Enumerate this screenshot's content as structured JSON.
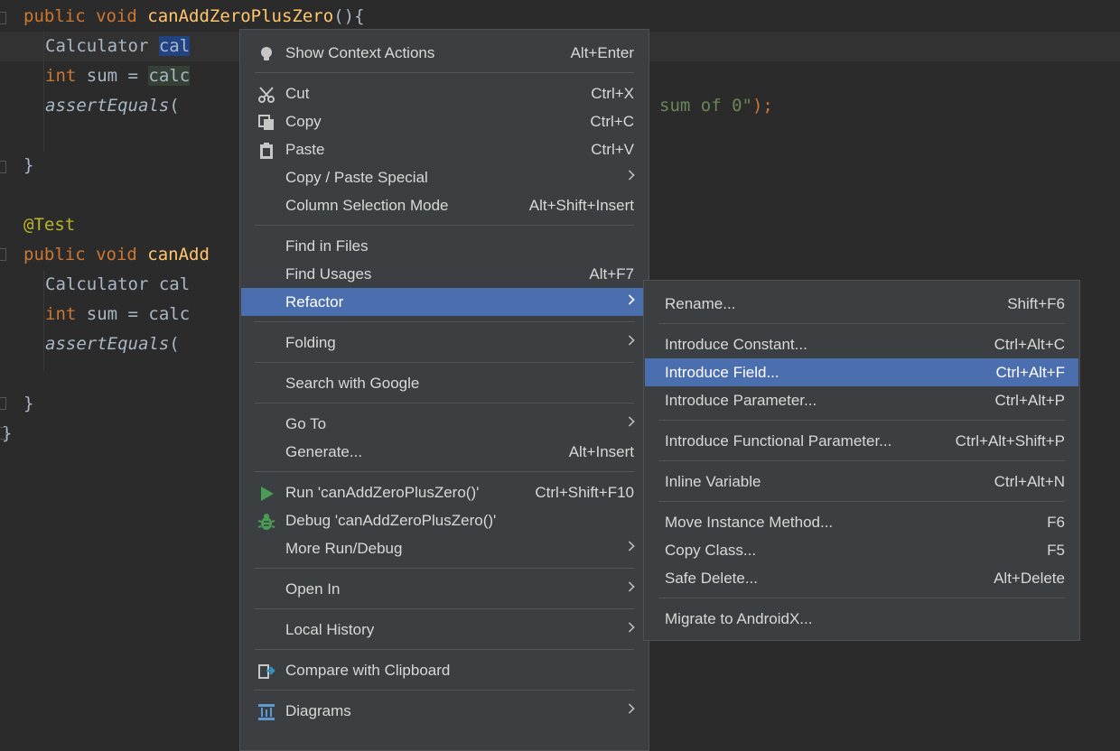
{
  "editor": {
    "lines": [
      {
        "tokens": [
          {
            "t": "public void ",
            "c": "kw"
          },
          {
            "t": "canAddZeroPlusZero",
            "c": "fn"
          },
          {
            "t": "(){",
            "c": ""
          }
        ],
        "indent": 2
      },
      {
        "tokens": [
          {
            "t": "Calculator ",
            "c": ""
          },
          {
            "t": "cal",
            "c": "sel"
          }
        ],
        "indent": 4,
        "current": true
      },
      {
        "tokens": [
          {
            "t": "int ",
            "c": "kw"
          },
          {
            "t": "sum = ",
            "c": ""
          },
          {
            "t": "calc",
            "c": "ref"
          }
        ],
        "indent": 4
      },
      {
        "tokens": [
          {
            "t": "assertEquals",
            "c": "it"
          },
          {
            "t": "(",
            "c": ""
          }
        ],
        "indent": 4,
        "tail": [
          {
            "t": "sum of 0\"",
            "c": "str"
          },
          {
            "t": ");",
            "c": "kw"
          }
        ]
      },
      {
        "tokens": [],
        "indent": 0
      },
      {
        "tokens": [
          {
            "t": "}",
            "c": ""
          }
        ],
        "indent": 2
      },
      {
        "tokens": [],
        "indent": 0
      },
      {
        "tokens": [
          {
            "t": "@Test",
            "c": "ann"
          }
        ],
        "indent": 2
      },
      {
        "tokens": [
          {
            "t": "public void ",
            "c": "kw"
          },
          {
            "t": "canAdd",
            "c": "fn"
          }
        ],
        "indent": 2
      },
      {
        "tokens": [
          {
            "t": "Calculator ",
            "c": ""
          },
          {
            "t": "cal",
            "c": ""
          }
        ],
        "indent": 4
      },
      {
        "tokens": [
          {
            "t": "int ",
            "c": "kw"
          },
          {
            "t": "sum = ",
            "c": ""
          },
          {
            "t": "calc",
            "c": ""
          }
        ],
        "indent": 4
      },
      {
        "tokens": [
          {
            "t": "assertEquals",
            "c": "it"
          },
          {
            "t": "(",
            "c": ""
          }
        ],
        "indent": 4
      },
      {
        "tokens": [],
        "indent": 0
      },
      {
        "tokens": [
          {
            "t": "}",
            "c": ""
          }
        ],
        "indent": 2
      },
      {
        "tokens": [
          {
            "t": "}",
            "c": ""
          }
        ],
        "indent": 0
      }
    ]
  },
  "context_menu": {
    "items": [
      {
        "label": "Show Context Actions",
        "shortcut": "Alt+Enter",
        "icon": "lightbulb-icon"
      },
      {
        "sep": true
      },
      {
        "label": "Cut",
        "shortcut": "Ctrl+X",
        "icon": "scissors-icon"
      },
      {
        "label": "Copy",
        "shortcut": "Ctrl+C",
        "icon": "copy-icon"
      },
      {
        "label": "Paste",
        "shortcut": "Ctrl+V",
        "icon": "clipboard-icon"
      },
      {
        "label": "Copy / Paste Special",
        "submenu": true
      },
      {
        "label": "Column Selection Mode",
        "shortcut": "Alt+Shift+Insert"
      },
      {
        "sep": true
      },
      {
        "label": "Find in Files"
      },
      {
        "label": "Find Usages",
        "shortcut": "Alt+F7"
      },
      {
        "label": "Refactor",
        "submenu": true,
        "highlighted": true
      },
      {
        "sep": true
      },
      {
        "label": "Folding",
        "submenu": true
      },
      {
        "sep": true
      },
      {
        "label": "Search with Google"
      },
      {
        "sep": true
      },
      {
        "label": "Go To",
        "submenu": true
      },
      {
        "label": "Generate...",
        "shortcut": "Alt+Insert"
      },
      {
        "sep": true
      },
      {
        "label": "Run 'canAddZeroPlusZero()'",
        "shortcut": "Ctrl+Shift+F10",
        "icon": "run-icon"
      },
      {
        "label": "Debug 'canAddZeroPlusZero()'",
        "icon": "bug-icon"
      },
      {
        "label": "More Run/Debug",
        "submenu": true
      },
      {
        "sep": true
      },
      {
        "label": "Open In",
        "submenu": true
      },
      {
        "sep": true
      },
      {
        "label": "Local History",
        "submenu": true
      },
      {
        "sep": true
      },
      {
        "label": "Compare with Clipboard",
        "icon": "compare-icon"
      },
      {
        "sep": true
      },
      {
        "label": "Diagrams",
        "submenu": true,
        "icon": "diagram-icon"
      }
    ]
  },
  "refactor_menu": {
    "items": [
      {
        "label": "Rename...",
        "shortcut": "Shift+F6"
      },
      {
        "sep": true
      },
      {
        "label": "Introduce Constant...",
        "shortcut": "Ctrl+Alt+C"
      },
      {
        "label": "Introduce Field...",
        "shortcut": "Ctrl+Alt+F",
        "highlighted": true
      },
      {
        "label": "Introduce Parameter...",
        "shortcut": "Ctrl+Alt+P"
      },
      {
        "sep": true
      },
      {
        "label": "Introduce Functional Parameter...",
        "shortcut": "Ctrl+Alt+Shift+P"
      },
      {
        "sep": true
      },
      {
        "label": "Inline Variable",
        "shortcut": "Ctrl+Alt+N"
      },
      {
        "sep": true
      },
      {
        "label": "Move Instance Method...",
        "shortcut": "F6"
      },
      {
        "label": "Copy Class...",
        "shortcut": "F5"
      },
      {
        "label": "Safe Delete...",
        "shortcut": "Alt+Delete"
      },
      {
        "sep": true
      },
      {
        "label": "Migrate to AndroidX..."
      }
    ]
  }
}
